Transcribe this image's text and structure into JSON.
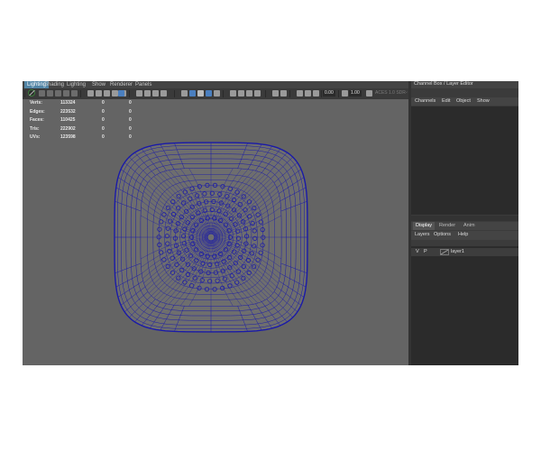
{
  "menubar": {
    "items": [
      "Lighting",
      "Shading",
      "Lighting",
      "Show",
      "Renderer",
      "Panels"
    ],
    "active_index": 0
  },
  "toolbar": {
    "field1": "0.00",
    "field2": "1.00",
    "color_mgmt": "ACES 1.0 SDR-video (sRGB)"
  },
  "hud": {
    "rows": [
      {
        "label": "Verts:",
        "v1": "113324",
        "v2": "0",
        "v3": "0"
      },
      {
        "label": "Edges:",
        "v1": "223532",
        "v2": "0",
        "v3": "0"
      },
      {
        "label": "Faces:",
        "v1": "110425",
        "v2": "0",
        "v3": "0"
      },
      {
        "label": "Tris:",
        "v1": "222902",
        "v2": "0",
        "v3": "0"
      },
      {
        "label": "UVs:",
        "v1": "123598",
        "v2": "0",
        "v3": "0"
      }
    ]
  },
  "channel_box": {
    "title": "Channel Box / Layer Editor",
    "menu": [
      "Channels",
      "Edit",
      "Object",
      "Show"
    ]
  },
  "layer_editor": {
    "tabs": [
      "Display",
      "Render",
      "Anim"
    ],
    "active_tab_index": 0,
    "menu": [
      "Layers",
      "Options",
      "Help"
    ],
    "layers": [
      {
        "v": "V",
        "p": "P",
        "name": "layer1"
      }
    ]
  },
  "colors": {
    "viewport_bg": "#646464",
    "wireframe": "#1a1aa8",
    "mesh_fill": "#6e6e6e"
  }
}
